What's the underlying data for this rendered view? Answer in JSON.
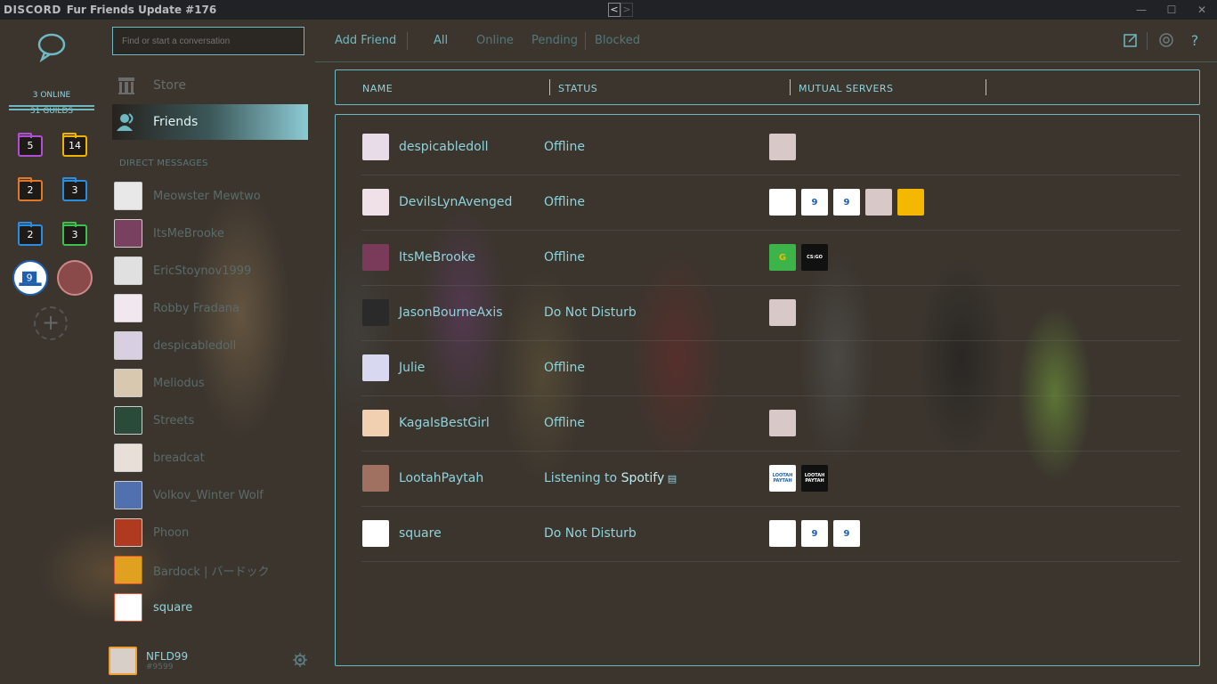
{
  "app": {
    "logo": "DISCORD",
    "title": "Fur Friends Update #176",
    "nav_back": "<",
    "nav_forward": ">"
  },
  "window_controls": {
    "minimize": "—",
    "maximize": "☐",
    "close": "✕"
  },
  "guilds": {
    "online_count": "3 ONLINE",
    "guild_count": "31 GUILDS",
    "folders": [
      {
        "count": "5",
        "color": "#b04fd6"
      },
      {
        "count": "14",
        "color": "#f0b400"
      },
      {
        "count": "2",
        "color": "#e0782a"
      },
      {
        "count": "3",
        "color": "#2a8de0"
      },
      {
        "count": "2",
        "color": "#2a8de0"
      },
      {
        "count": "3",
        "color": "#3cc24a"
      }
    ],
    "add_label": "+"
  },
  "channels": {
    "search_placeholder": "Find or start a conversation",
    "store_label": "Store",
    "friends_label": "Friends",
    "dm_header": "DIRECT MESSAGES",
    "dms": [
      {
        "name": "Meowster Mewtwo"
      },
      {
        "name": "ItsMeBrooke"
      },
      {
        "name": "EricStoynov1999"
      },
      {
        "name": "Robby Fradana"
      },
      {
        "name": "despicabledoll"
      },
      {
        "name": "Meliodus"
      },
      {
        "name": "Streets"
      },
      {
        "name": "breadcat"
      },
      {
        "name": "Volkov_Winter Wolf"
      },
      {
        "name": "Phoon"
      },
      {
        "name": "Bardock | バードック"
      },
      {
        "name": "square"
      }
    ]
  },
  "user": {
    "name": "NFLD99",
    "tag": "#9599"
  },
  "tabs": {
    "add_friend": "Add Friend",
    "all": "All",
    "online": "Online",
    "pending": "Pending",
    "blocked": "Blocked"
  },
  "columns": {
    "name": "NAME",
    "status": "STATUS",
    "mutual": "MUTUAL SERVERS"
  },
  "friends": [
    {
      "name": "despicabledoll",
      "status": "Offline",
      "status_extra": "",
      "servers": [
        {
          "label": "",
          "color": "#d8c8c8"
        }
      ]
    },
    {
      "name": "DevilsLynAvenged",
      "status": "Offline",
      "status_extra": "",
      "servers": [
        {
          "label": "",
          "color": "#ffffff"
        },
        {
          "label": "9",
          "color": "#ffffff"
        },
        {
          "label": "9",
          "color": "#ffffff"
        },
        {
          "label": "",
          "color": "#d8c8c8"
        },
        {
          "label": "",
          "color": "#f5b800"
        }
      ]
    },
    {
      "name": "ItsMeBrooke",
      "status": "Offline",
      "status_extra": "",
      "servers": [
        {
          "label": "G",
          "color": "#3cb44a"
        },
        {
          "label": "CS:GO",
          "color": "#111111"
        }
      ]
    },
    {
      "name": "JasonBourneAxis",
      "status": "Do Not Disturb",
      "status_extra": "",
      "servers": [
        {
          "label": "",
          "color": "#d8c8c8"
        }
      ]
    },
    {
      "name": "Julie",
      "status": "Offline",
      "status_extra": "",
      "servers": []
    },
    {
      "name": "KagaIsBestGirl",
      "status": "Offline",
      "status_extra": "",
      "servers": [
        {
          "label": "",
          "color": "#d8c8c8"
        }
      ]
    },
    {
      "name": "LootahPaytah",
      "status": "Listening to ",
      "status_extra": "Spotify",
      "servers": [
        {
          "label": "LOOTAH PAYTAH",
          "color": "#ffffff"
        },
        {
          "label": "LOOTAH PAYTAH",
          "color": "#111111"
        }
      ]
    },
    {
      "name": "square",
      "status": "Do Not Disturb",
      "status_extra": "",
      "servers": [
        {
          "label": "",
          "color": "#ffffff"
        },
        {
          "label": "9",
          "color": "#ffffff"
        },
        {
          "label": "9",
          "color": "#ffffff"
        }
      ]
    }
  ],
  "colors": {
    "accent": "#8fd3dc",
    "border": "#6fb8c2",
    "titlebar": "#202225"
  }
}
